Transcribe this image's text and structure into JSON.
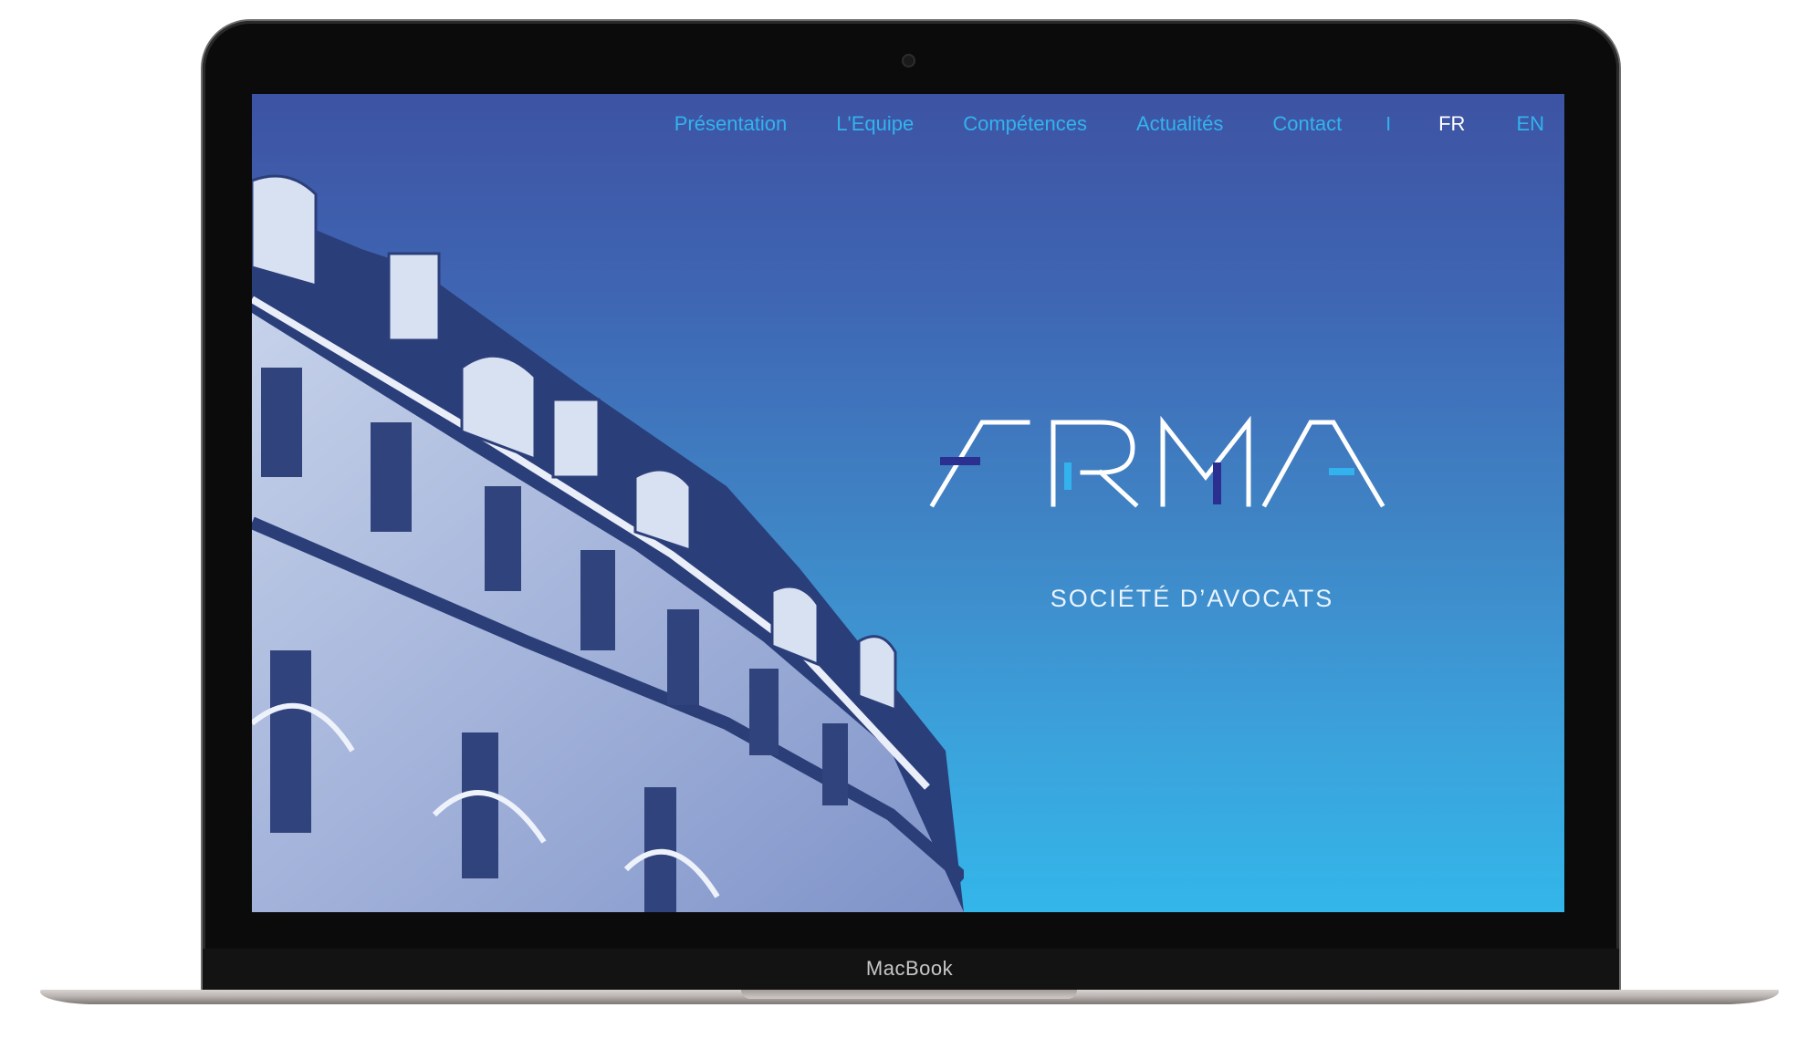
{
  "device": {
    "brand_label": "MacBook"
  },
  "site": {
    "nav": [
      "Présentation",
      "L'Equipe",
      "Compétences",
      "Actualités",
      "Contact"
    ],
    "separator": "I",
    "languages": {
      "fr": "FR",
      "en": "EN",
      "active": "FR"
    },
    "logo_text": "ARMA",
    "tagline": "SOCIÉTÉ D’AVOCATS"
  },
  "colors": {
    "accent": "#33b3ee",
    "logo_dark": "#2b2f8f",
    "logo_light": "#33b3ee",
    "gradient_top": "#3d53a3",
    "gradient_bottom": "#33b6ea"
  }
}
